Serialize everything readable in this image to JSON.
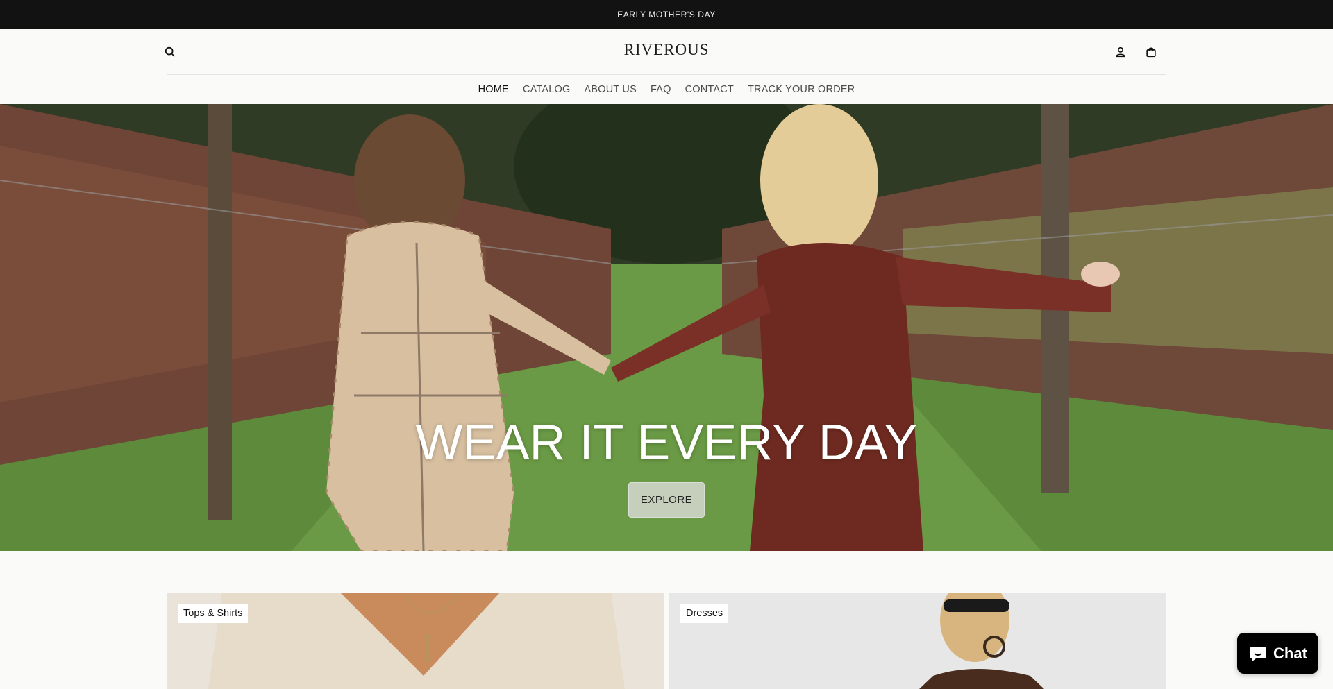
{
  "announcement": {
    "text": "EARLY MOTHER'S DAY"
  },
  "header": {
    "logo": "RIVEROUS",
    "icons": {
      "search": "search-icon",
      "account": "account-icon",
      "cart": "cart-icon"
    }
  },
  "nav": {
    "items": [
      {
        "label": "HOME",
        "active": true
      },
      {
        "label": "CATALOG",
        "active": false
      },
      {
        "label": "ABOUT US",
        "active": false
      },
      {
        "label": "FAQ",
        "active": false
      },
      {
        "label": "CONTACT",
        "active": false
      },
      {
        "label": "TRACK YOUR ORDER",
        "active": false
      }
    ]
  },
  "hero": {
    "title": "WEAR IT EVERY DAY",
    "button_label": "EXPLORE"
  },
  "collections": [
    {
      "label": "Tops & Shirts"
    },
    {
      "label": "Dresses"
    }
  ],
  "chat": {
    "label": "Chat",
    "icon": "chat-bubble-icon"
  },
  "colors": {
    "announcement_bg": "#121212",
    "page_bg": "#fafaf8",
    "chat_bg": "#000000"
  }
}
